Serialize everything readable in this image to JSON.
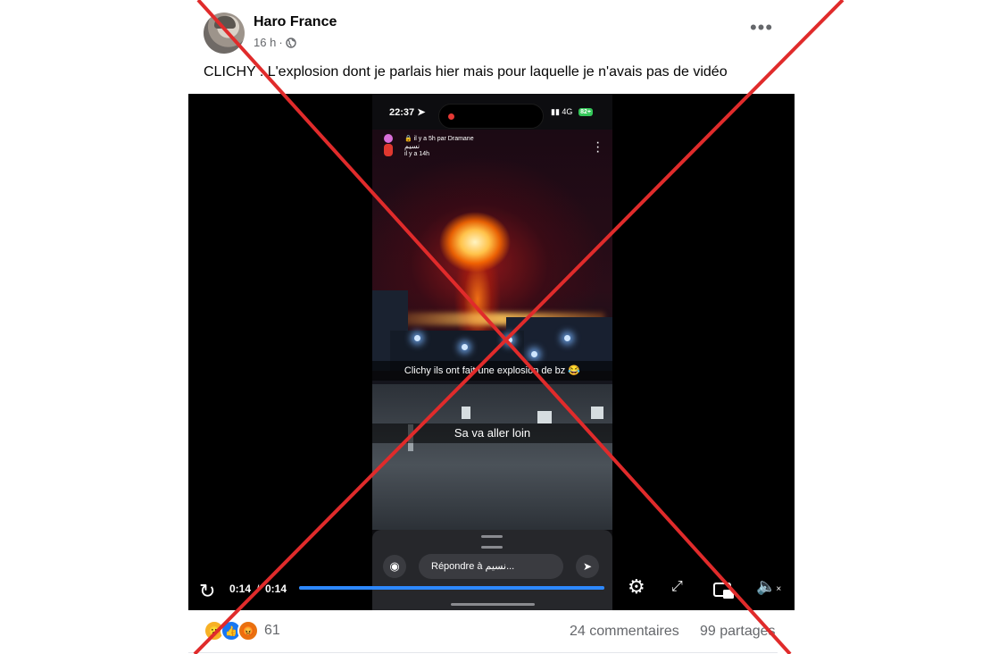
{
  "post": {
    "author": "Haro France",
    "time": "16 h",
    "separator": "·",
    "caption": "CLICHY : L'explosion dont je parlais hier mais pour laquelle je n'avais pas de vidéo",
    "more_label": "•••"
  },
  "phone": {
    "status_time": "22:37",
    "network": "4G",
    "battery": "82+",
    "story_meta": "il y a 5h par Dramane",
    "story_user": "نسيم",
    "story_age": "il y a 14h",
    "caption1": "Clichy ils ont fait une explosion de bz 😂",
    "caption2": "Sa va aller loin",
    "reply_placeholder": "Répondre à نسيم..."
  },
  "player": {
    "current_time": "0:14",
    "time_separator": "/",
    "duration": "0:14",
    "progress_percent": 100
  },
  "footer": {
    "reaction_count": "61",
    "comments": "24 commentaires",
    "shares": "99 partages"
  },
  "colors": {
    "accent_blue": "#2d88ff",
    "cross_red": "#e02b2b",
    "text_secondary": "#65676b"
  },
  "icons": [
    "globe-icon",
    "more-icon",
    "location-arrow-icon",
    "camera-icon",
    "send-icon",
    "replay-icon",
    "settings-icon",
    "fullscreen-icon",
    "pip-icon",
    "mute-icon",
    "wow-reaction-icon",
    "like-reaction-icon",
    "angry-reaction-icon"
  ]
}
